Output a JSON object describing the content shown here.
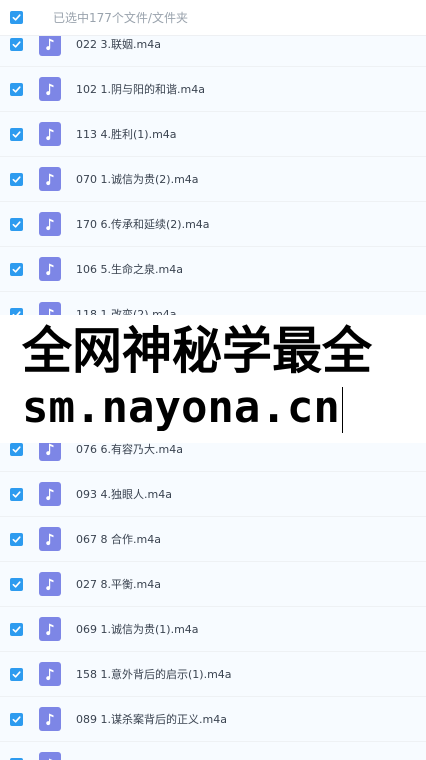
{
  "header": {
    "selection_text": "已选中177个文件/文件夹"
  },
  "files": [
    {
      "name": "022 3.联姻.m4a"
    },
    {
      "name": "102 1.阴与阳的和谐.m4a"
    },
    {
      "name": "113 4.胜利(1).m4a"
    },
    {
      "name": "070 1.诚信为贵(2).m4a"
    },
    {
      "name": "170 6.传承和延续(2).m4a"
    },
    {
      "name": "106 5.生命之泉.m4a"
    },
    {
      "name": "118 1.改变(2).m4a"
    },
    {
      "name": ""
    },
    {
      "name": ""
    },
    {
      "name": "076 6.有容乃大.m4a"
    },
    {
      "name": "093 4.独眼人.m4a"
    },
    {
      "name": "067 8 合作.m4a"
    },
    {
      "name": "027 8.平衡.m4a"
    },
    {
      "name": "069 1.诚信为贵(1).m4a"
    },
    {
      "name": "158 1.意外背后的启示(1).m4a"
    },
    {
      "name": "089 1.谋杀案背后的正义.m4a"
    },
    {
      "name": ""
    }
  ],
  "watermark": {
    "line1": "全网神秘学最全",
    "line2": "sm.nayona.cn"
  },
  "colors": {
    "checkbox": "#2d9bef",
    "audio_icon": "#7d86e6"
  },
  "icons": {
    "check": "check-icon",
    "file": "music-note-icon"
  }
}
